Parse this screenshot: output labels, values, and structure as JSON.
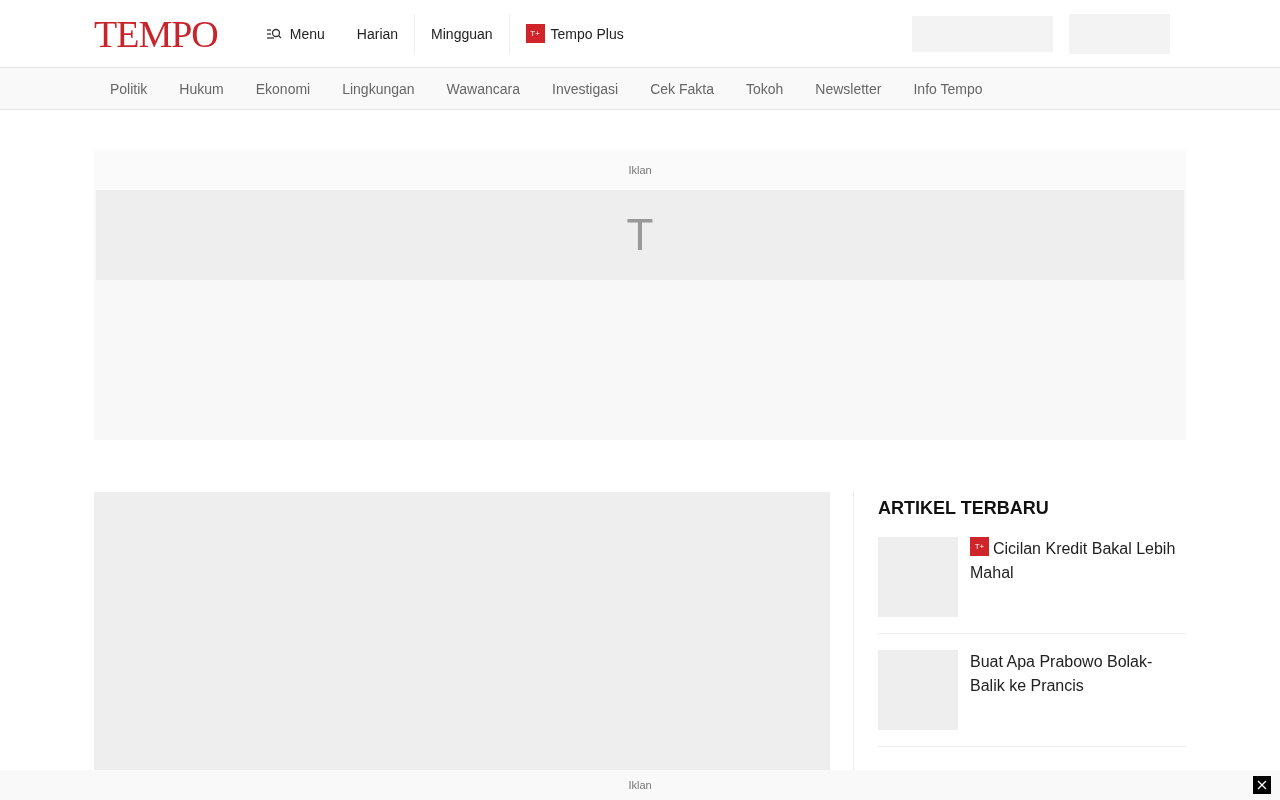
{
  "header": {
    "logo": "TEMPO",
    "menu": "Menu",
    "links": [
      {
        "label": "Harian"
      },
      {
        "label": "Mingguan"
      },
      {
        "label": "Tempo Plus",
        "badge": "T+"
      }
    ]
  },
  "categories": [
    "Politik",
    "Hukum",
    "Ekonomi",
    "Lingkungan",
    "Wawancara",
    "Investigasi",
    "Cek Fakta",
    "Tokoh",
    "Newsletter",
    "Info Tempo"
  ],
  "top_ad": {
    "label": "Iklan",
    "mark": "T"
  },
  "sidebar": {
    "title": "ARTIKEL TERBARU",
    "articles": [
      {
        "badge": "T+",
        "title": "Cicilan Kredit Bakal Lebih Mahal"
      },
      {
        "title": "Buat Apa Prabowo Bolak-Balik ke Prancis"
      }
    ]
  },
  "bottom_ad": {
    "label": "Iklan"
  }
}
